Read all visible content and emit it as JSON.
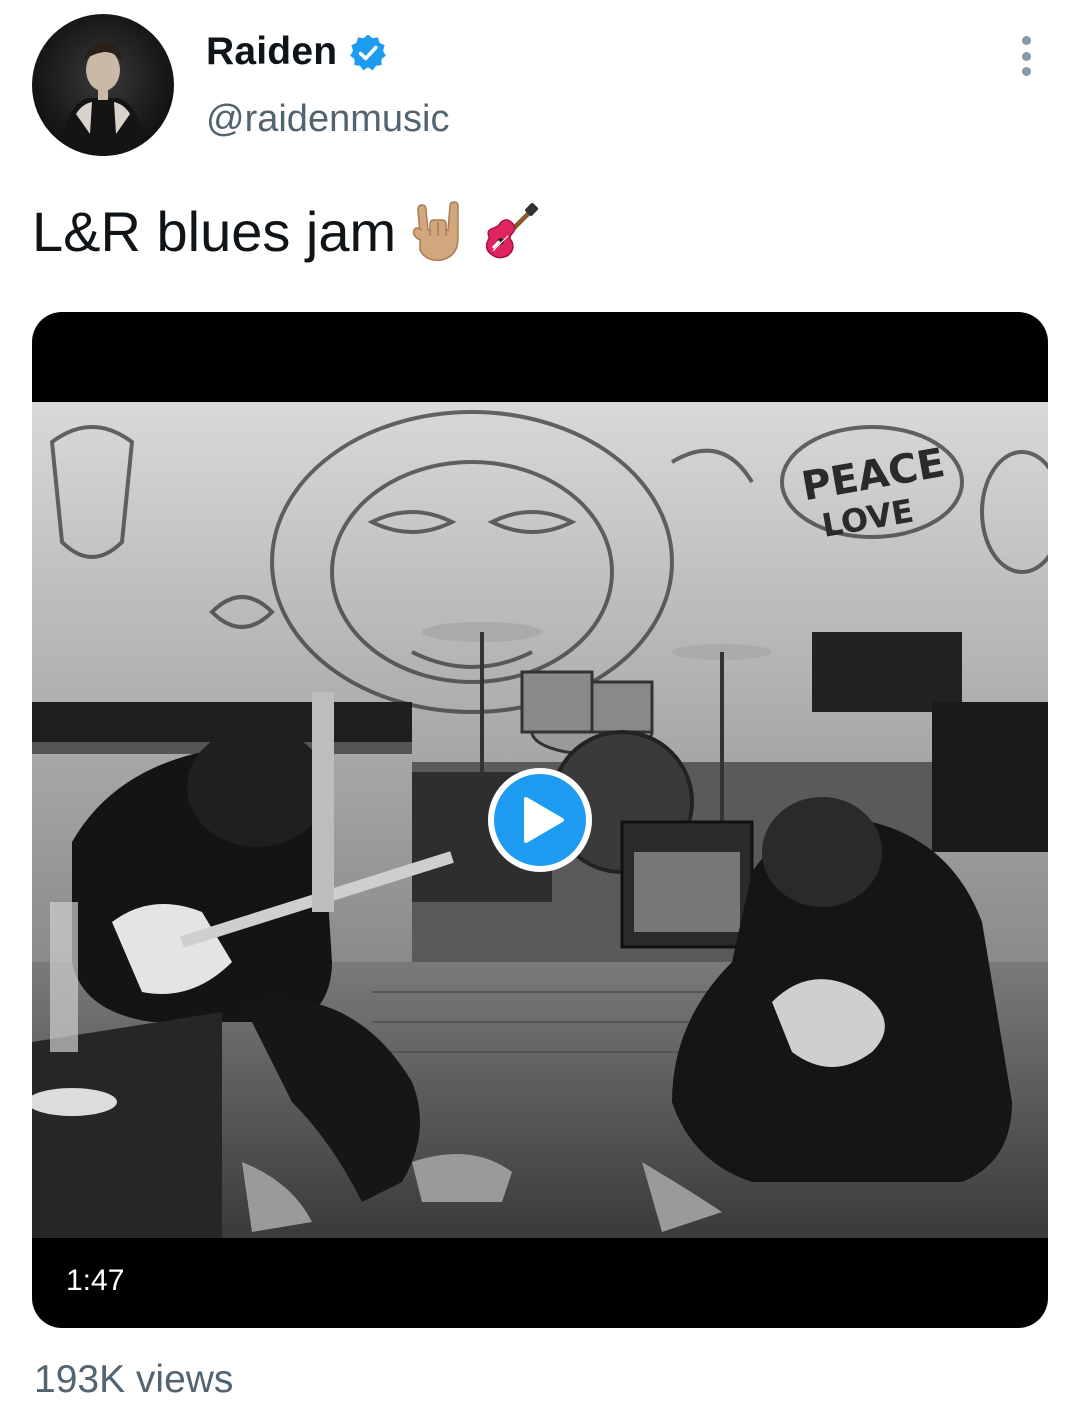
{
  "user": {
    "display_name": "Raiden",
    "handle": "@raidenmusic",
    "verified": true,
    "verified_color": "#1d9bf0"
  },
  "tweet": {
    "text": "L&R blues jam",
    "emojis": [
      "sign-of-the-horns-emoji",
      "guitar-emoji"
    ]
  },
  "media": {
    "type": "video",
    "duration": "1:47",
    "play_button_color": "#1d9bf0"
  },
  "stats": {
    "views": "193K views"
  },
  "icons": {
    "more": "more-vertical-icon",
    "verified": "verified-badge-icon",
    "play": "play-icon"
  },
  "colors": {
    "text_primary": "#0f1419",
    "text_secondary": "#536471",
    "accent": "#1d9bf0"
  }
}
